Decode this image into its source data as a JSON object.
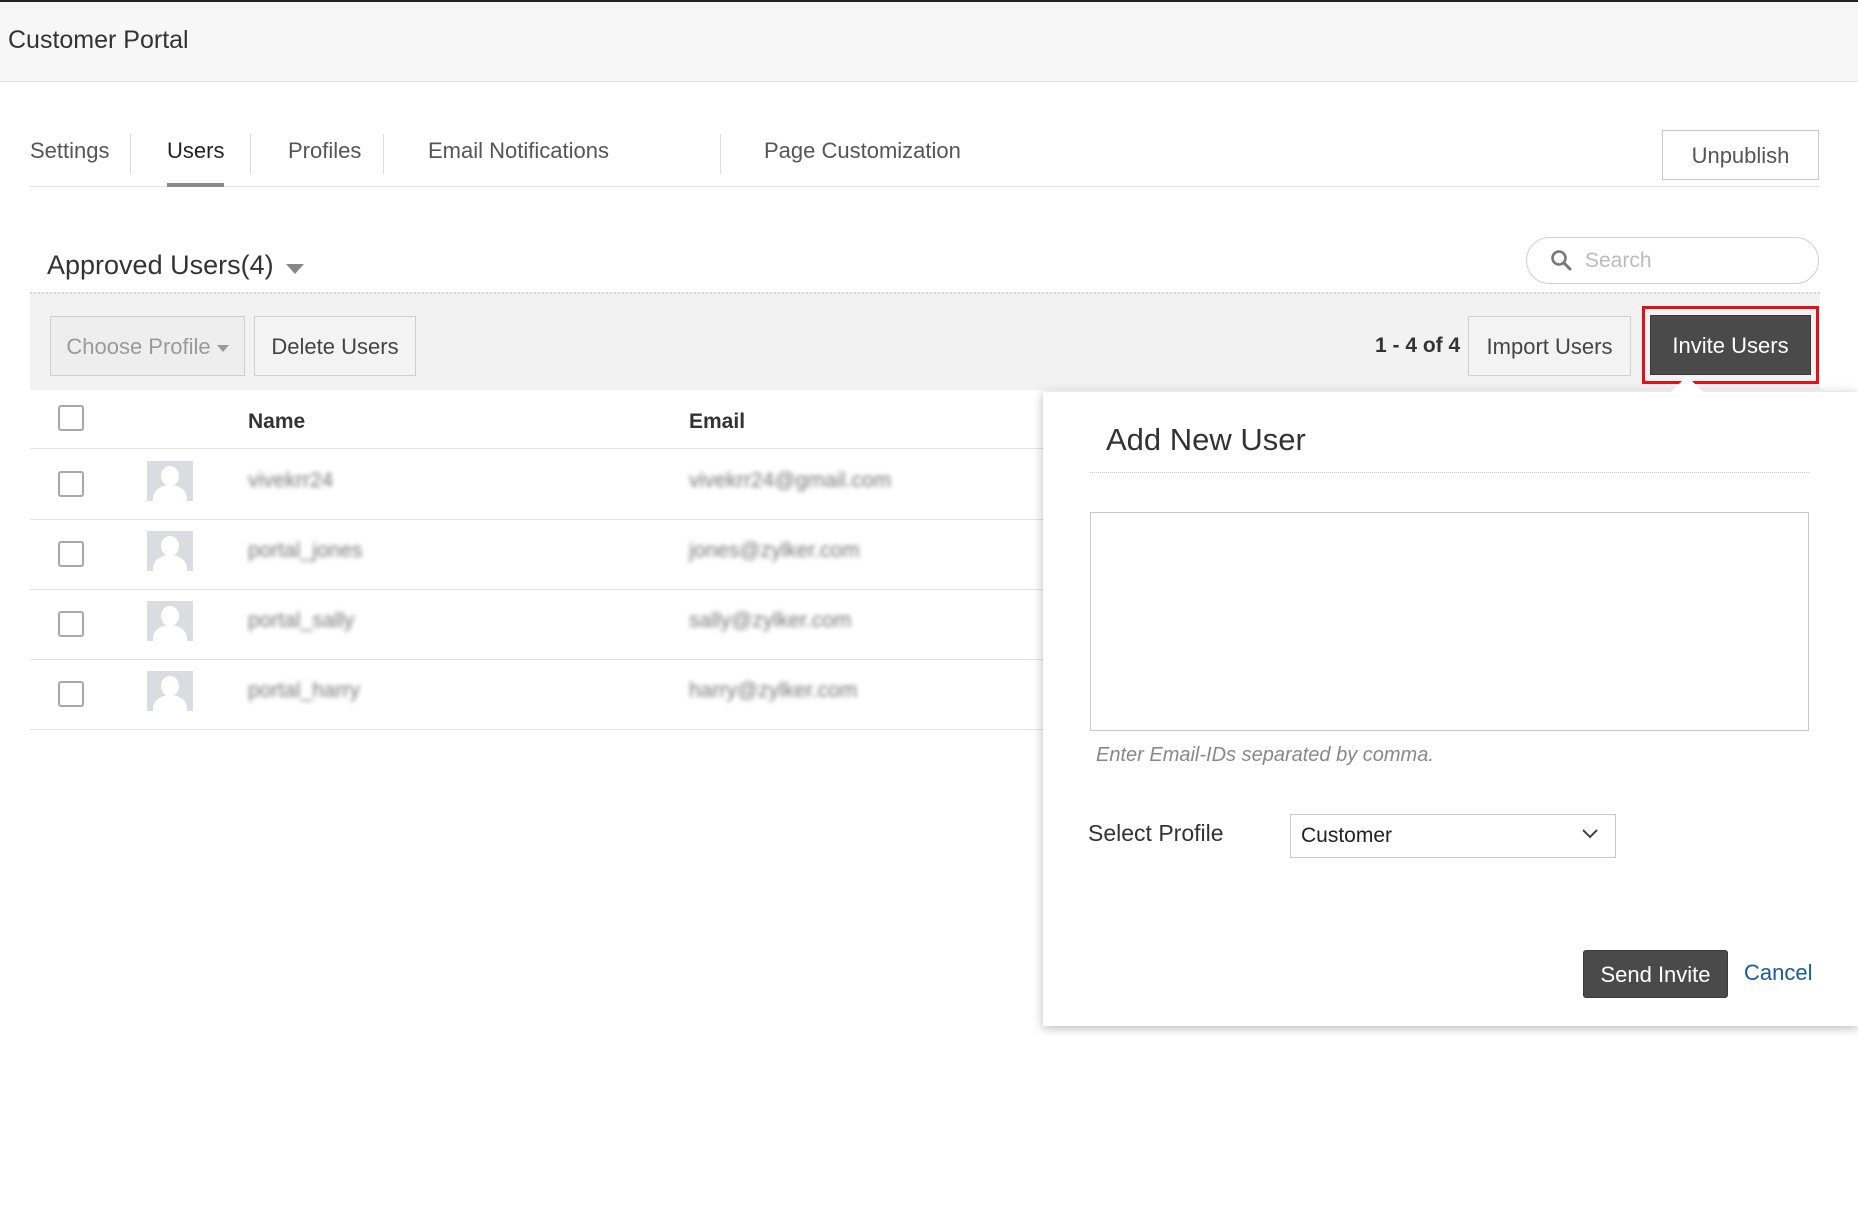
{
  "app": {
    "title": "Customer Portal"
  },
  "tabs": [
    {
      "label": "Settings",
      "active": false
    },
    {
      "label": "Users",
      "active": true
    },
    {
      "label": "Profiles",
      "active": false
    },
    {
      "label": "Email Notifications",
      "active": false
    },
    {
      "label": "Page Customization",
      "active": false
    }
  ],
  "header": {
    "unpublish_label": "Unpublish"
  },
  "section": {
    "title": "Approved Users(4)"
  },
  "search": {
    "placeholder": "Search"
  },
  "toolbar": {
    "choose_profile_label": "Choose Profile",
    "delete_users_label": "Delete Users",
    "page_count": "1 - 4 of 4",
    "import_users_label": "Import Users",
    "invite_users_label": "Invite Users"
  },
  "table": {
    "columns": [
      "Name",
      "Email"
    ],
    "rows": [
      {
        "name": "vivekrr24",
        "email": "vivekrr24@gmail.com"
      },
      {
        "name": "portal_jones",
        "email": "jones@zylker.com"
      },
      {
        "name": "portal_sally",
        "email": "sally@zylker.com"
      },
      {
        "name": "portal_harry",
        "email": "harry@zylker.com"
      }
    ]
  },
  "invite_popover": {
    "title": "Add New User",
    "email_value": "",
    "hint": "Enter Email-IDs separated by comma.",
    "select_profile_label": "Select Profile",
    "selected_profile": "Customer",
    "send_invite_label": "Send Invite",
    "cancel_label": "Cancel"
  },
  "colors": {
    "highlight": "#e3101a",
    "primary_button": "#4a4a4a",
    "link": "#1a5ba0"
  }
}
